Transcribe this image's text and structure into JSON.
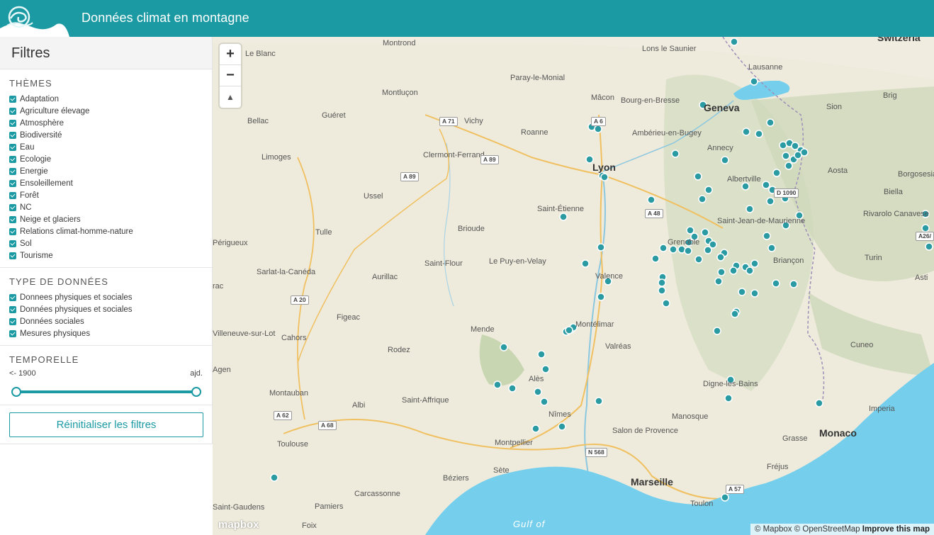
{
  "header": {
    "title": "Données climat en montagne",
    "logo_icon": "wave-logo-icon"
  },
  "sidebar": {
    "title": "Filtres",
    "themes": {
      "title": "Thèmes",
      "items": [
        {
          "label": "Adaptation",
          "checked": true
        },
        {
          "label": "Agriculture élevage",
          "checked": true
        },
        {
          "label": "Atmosphère",
          "checked": true
        },
        {
          "label": "Biodiversité",
          "checked": true
        },
        {
          "label": "Eau",
          "checked": true
        },
        {
          "label": "Ecologie",
          "checked": true
        },
        {
          "label": "Energie",
          "checked": true
        },
        {
          "label": "Ensoleillement",
          "checked": true
        },
        {
          "label": "Forêt",
          "checked": true
        },
        {
          "label": "NC",
          "checked": true
        },
        {
          "label": "Neige et glaciers",
          "checked": true
        },
        {
          "label": "Relations climat-homme-nature",
          "checked": true
        },
        {
          "label": "Sol",
          "checked": true
        },
        {
          "label": "Tourisme",
          "checked": true
        }
      ]
    },
    "data_types": {
      "title": "Type de données",
      "items": [
        {
          "label": "Donnees physiques et sociales",
          "checked": true
        },
        {
          "label": "Données physiques et sociales",
          "checked": true
        },
        {
          "label": "Données sociales",
          "checked": true
        },
        {
          "label": "Mesures physiques",
          "checked": true
        }
      ]
    },
    "temporal": {
      "title": "Temporelle",
      "min_label": "<- 1900",
      "max_label": "ajd.",
      "range_start_fraction": 0,
      "range_end_fraction": 1
    },
    "reset_label": "Réinitialiser les filtres"
  },
  "map": {
    "zoom_in": "+",
    "zoom_out": "−",
    "compass": "▲",
    "mapbox_logo": "mapbox",
    "attribution": {
      "mapbox": "© Mapbox",
      "osm": "© OpenStreetMap",
      "improve": "Improve this map"
    },
    "colors": {
      "marker": "#2a9aa3",
      "sea": "#75cfec",
      "land": "#eeebdc",
      "accent": "#1b9aa3"
    },
    "places": {
      "montrond": "Montrond",
      "lons": "Lons le Saunier",
      "switzerland": "Switzerla",
      "leblanc": "Le Blanc",
      "paray": "Paray-le-Monial",
      "lausanne": "Lausanne",
      "montlucon": "Montluçon",
      "macon": "Mâcon",
      "bourg": "Bourg-en-Bresse",
      "brig": "Brig",
      "gueret": "Guéret",
      "vichy": "Vichy",
      "geneva": "Geneva",
      "sion": "Sion",
      "bellac": "Bellac",
      "roanne": "Roanne",
      "amberieu": "Ambérieu-en-Bugey",
      "annecy": "Annecy",
      "limoges": "Limoges",
      "clermont": "Clermont-Ferrand",
      "lyon": "Lyon",
      "aosta": "Aosta",
      "albertville": "Albertville",
      "borgosesia": "Borgosesia",
      "ussel": "Ussel",
      "biella": "Biella",
      "saintetienne": "Saint-Étienne",
      "rivarolo": "Rivarolo Canavese",
      "sjdm": "Saint-Jean-de-Maurienne",
      "tulle": "Tulle",
      "brioude": "Brioude",
      "perigueux": "Périgueux",
      "grenoble": "Grenoble",
      "turin": "Turin",
      "sarlat": "Sarlat-la-Canéda",
      "aurillac": "Aurillac",
      "saintflour": "Saint-Flour",
      "lepuy": "Le Puy-en-Velay",
      "valence": "Valence",
      "briancon": "Briançon",
      "asti": "Asti",
      "rac": "rac",
      "figeac": "Figeac",
      "mende": "Mende",
      "montelimar": "Montélimar",
      "villeneuve": "Villeneuve-sur-Lot",
      "cahors": "Cahors",
      "cuneo": "Cuneo",
      "rodez": "Rodez",
      "valreas": "Valréas",
      "agen": "Agen",
      "ales": "Alès",
      "digne": "Digne-les-Bains",
      "montauban": "Montauban",
      "saintaffrique": "Saint-Affrique",
      "albi": "Albi",
      "imperia": "Imperia",
      "nimes": "Nîmes",
      "manosque": "Manosque",
      "monaco": "Monaco",
      "toulouse": "Toulouse",
      "montpellier": "Montpellier",
      "salon": "Salon de Provence",
      "grasse": "Grasse",
      "sete": "Sète",
      "beziers": "Béziers",
      "marseille": "Marseille",
      "frejus": "Fréjus",
      "carcassonne": "Carcassonne",
      "toulon": "Toulon",
      "saintgaudens": "Saint-Gaudens",
      "pamiers": "Pamiers",
      "foix": "Foix",
      "gulf": "Gulf of"
    },
    "roads": {
      "a71": "A 71",
      "a6": "A 6",
      "a89a": "A 89",
      "a89b": "A 89",
      "a48": "A 48",
      "d1090": "D 1090",
      "a20": "A 20",
      "a26": "A26/",
      "a62": "A 62",
      "a68": "A 68",
      "n568": "N 568",
      "a57": "A 57"
    }
  }
}
